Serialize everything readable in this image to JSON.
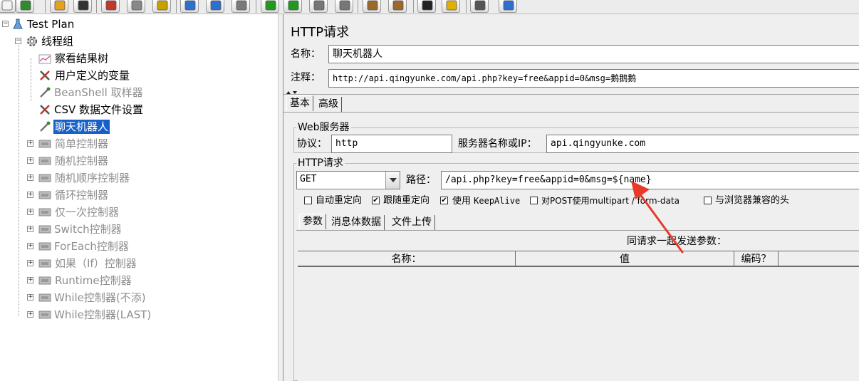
{
  "toolbar": {
    "icons": [
      "new-icon",
      "templates-icon",
      "open-icon",
      "save-icon",
      "cut-icon",
      "copy-icon",
      "paste-icon",
      "expand-icon",
      "collapse-icon",
      "toggle-icon",
      "start-icon",
      "start-no-pause-icon",
      "stop-icon",
      "shutdown-icon",
      "clear-icon",
      "clear-all-icon",
      "search-icon",
      "reset-search-icon",
      "function-helper-icon",
      "help-icon"
    ]
  },
  "tree": {
    "items": [
      {
        "label": "Test Plan",
        "icon": "flask-icon",
        "expander": "⊟",
        "state": "normal"
      },
      {
        "label": "线程组",
        "icon": "gear-icon",
        "expander": "⊟",
        "state": "normal"
      },
      {
        "label": "察看结果树",
        "icon": "graph-icon",
        "expander": "",
        "state": "normal"
      },
      {
        "label": "用户定义的变量",
        "icon": "wrench-icon",
        "expander": "",
        "state": "normal"
      },
      {
        "label": "BeanShell 取样器",
        "icon": "pipette-icon",
        "expander": "",
        "state": "disabled"
      },
      {
        "label": "CSV 数据文件设置",
        "icon": "wrench-icon",
        "expander": "",
        "state": "normal"
      },
      {
        "label": "聊天机器人",
        "icon": "pipette-icon",
        "expander": "",
        "state": "selected"
      },
      {
        "label": "简单控制器",
        "icon": "controller-icon",
        "expander": "⊞",
        "state": "disabled"
      },
      {
        "label": "随机控制器",
        "icon": "controller-icon",
        "expander": "⊞",
        "state": "disabled"
      },
      {
        "label": "随机顺序控制器",
        "icon": "controller-icon",
        "expander": "⊞",
        "state": "disabled"
      },
      {
        "label": "循环控制器",
        "icon": "controller-icon",
        "expander": "⊞",
        "state": "disabled"
      },
      {
        "label": "仅一次控制器",
        "icon": "controller-icon",
        "expander": "⊞",
        "state": "disabled"
      },
      {
        "label": "Switch控制器",
        "icon": "controller-icon",
        "expander": "⊞",
        "state": "disabled"
      },
      {
        "label": "ForEach控制器",
        "icon": "controller-icon",
        "expander": "⊞",
        "state": "disabled"
      },
      {
        "label": "如果（If）控制器",
        "icon": "controller-icon",
        "expander": "⊞",
        "state": "disabled"
      },
      {
        "label": "Runtime控制器",
        "icon": "controller-icon",
        "expander": "⊞",
        "state": "disabled"
      },
      {
        "label": "While控制器(不添)",
        "icon": "controller-icon",
        "expander": "⊞",
        "state": "disabled"
      },
      {
        "label": "While控制器(LAST)",
        "icon": "controller-icon",
        "expander": "⊞",
        "state": "disabled"
      }
    ]
  },
  "panel": {
    "title": "HTTP请求",
    "name_label": "名称：",
    "name_value": "聊天机器人",
    "comment_label": "注释：",
    "comment_value": "http://api.qingyunke.com/api.php?key=free&appid=0&msg=鹅鹅鹅",
    "tabs": [
      "基本",
      "高级"
    ],
    "web_server": {
      "group_title": "Web服务器",
      "protocol_label": "协议：",
      "protocol_value": "http",
      "server_label": "服务器名称或IP：",
      "server_value": "api.qingyunke.com"
    },
    "http_request": {
      "group_title": "HTTP请求",
      "method": "GET",
      "path_label": "路径：",
      "path_value": "/api.php?key=free&appid=0&msg=${name}",
      "options": [
        {
          "label": "自动重定向",
          "checked": false
        },
        {
          "label": "跟随重定向",
          "checked": true
        },
        {
          "label_cjk": "使用 ",
          "label_mono": "KeepAlive",
          "checked": true
        },
        {
          "label_cjk": "对POST使用multipart / form-data",
          "checked": false
        },
        {
          "label": "与浏览器兼容的头",
          "checked": false
        }
      ],
      "sub_tabs": [
        "参数",
        "消息体数据",
        "文件上传"
      ],
      "params_caption": "同请求一起发送参数：",
      "columns": [
        "名称：",
        "值",
        "编码？"
      ]
    }
  },
  "colors": {
    "selection": "#1660c8",
    "annotation_arrow": "#e8392b",
    "disabled_text": "#8e8e8e"
  }
}
